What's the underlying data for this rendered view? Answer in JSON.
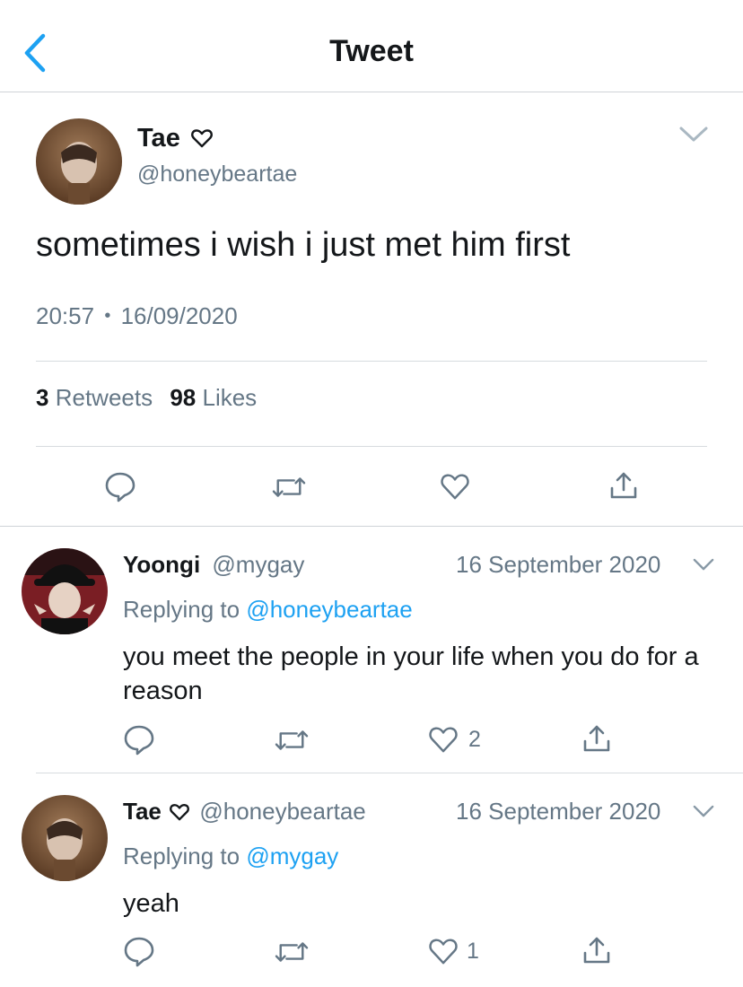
{
  "header": {
    "title": "Tweet"
  },
  "main_tweet": {
    "name": "Tae",
    "handle": "@honeybeartae",
    "text": "sometimes i wish i just met him first",
    "time": "20:57",
    "dot": "•",
    "date": "16/09/2020",
    "retweets_count": "3",
    "retweets_label": "Retweets",
    "likes_count": "98",
    "likes_label": "Likes"
  },
  "replies": [
    {
      "name": "Yoongi",
      "handle": "@mygay",
      "date": "16 September 2020",
      "replying_prefix": "Replying to",
      "replying_handle": "@honeybeartae",
      "text": "you meet the people in your life when you do for a reason",
      "like_count": "2"
    },
    {
      "name": "Tae",
      "handle": "@honeybeartae",
      "date": "16 September 2020",
      "replying_prefix": "Replying to",
      "replying_handle": "@mygay",
      "text": "yeah",
      "like_count": "1"
    }
  ],
  "icons": [
    "chevron-left-icon",
    "chevron-down-icon",
    "heart-outline-icon",
    "reply-icon",
    "retweet-icon",
    "like-icon",
    "share-icon"
  ],
  "colors": {
    "accent": "#1da1f2",
    "secondary_text": "#657786",
    "primary_text": "#14171a"
  }
}
